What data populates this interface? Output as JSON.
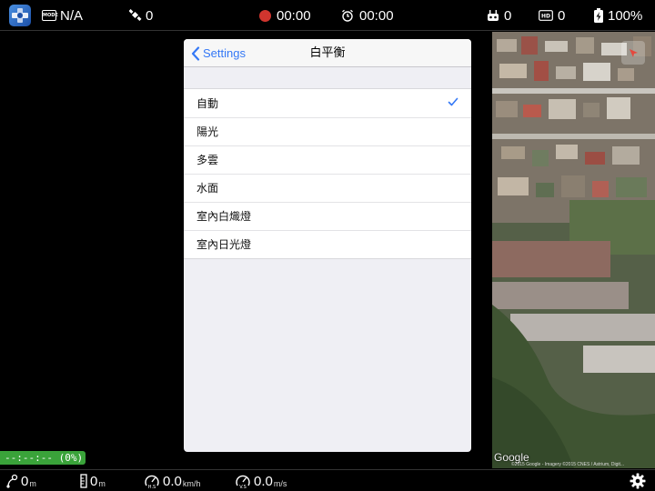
{
  "topbar": {
    "mode_badge": "MODE",
    "mode_value": "N/A",
    "satellite_count": "0",
    "record_time": "00:00",
    "timer_time": "00:00",
    "rc_signal": "0",
    "hd_signal": "0",
    "battery": "100%"
  },
  "panel": {
    "back_label": "Settings",
    "title": "白平衡",
    "options": [
      {
        "label": "自動",
        "selected": true
      },
      {
        "label": "陽光",
        "selected": false
      },
      {
        "label": "多雲",
        "selected": false
      },
      {
        "label": "水面",
        "selected": false
      },
      {
        "label": "室內白熾燈",
        "selected": false
      },
      {
        "label": "室內日光燈",
        "selected": false
      }
    ]
  },
  "map": {
    "logo": "Google",
    "attribution": "©2015 Google - Imagery ©2015 CNES / Astrium, Digit..."
  },
  "progress": {
    "text": "--:--:-- (0%)"
  },
  "bottombar": {
    "distance_value": "0",
    "distance_unit": "m",
    "altitude_value": "0",
    "altitude_unit": "m",
    "h_speed_value": "0.0",
    "h_speed_unit": "km/h",
    "v_speed_value": "0.0",
    "v_speed_unit": "m/s"
  },
  "colors": {
    "accent": "#3478f6",
    "record": "#d0352e",
    "progress": "#3aa33a"
  }
}
